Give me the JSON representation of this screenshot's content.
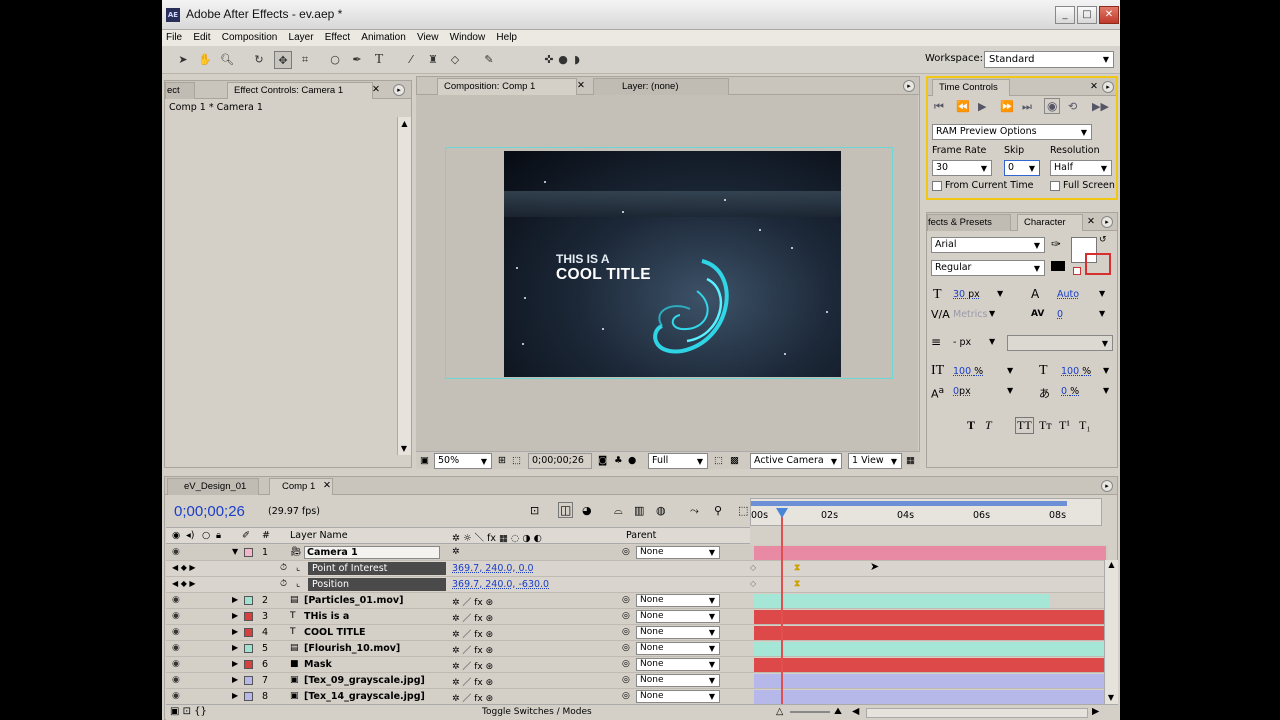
{
  "window": {
    "title": "Adobe After Effects - ev.aep *",
    "logo": "AE"
  },
  "menu": [
    "File",
    "Edit",
    "Composition",
    "Layer",
    "Effect",
    "Animation",
    "View",
    "Window",
    "Help"
  ],
  "workspace": {
    "label": "Workspace:",
    "value": "Standard"
  },
  "effect_controls": {
    "tab_left": "ect",
    "tab": "Effect Controls: Camera 1",
    "subtitle": "Comp 1 * Camera 1"
  },
  "composition": {
    "tab": "Composition: Comp 1",
    "layer_tab": "Layer: (none)",
    "title_line1": "THIS IS A",
    "title_line2": "COOL TITLE",
    "footer": {
      "zoom": "50%",
      "timecode": "0;00;00;26",
      "resolution": "Full",
      "camera": "Active Camera",
      "views": "1 View"
    }
  },
  "time_controls": {
    "tab": "Time Controls",
    "ram_preview": "RAM Preview Options",
    "frame_rate_label": "Frame Rate",
    "frame_rate": "30",
    "skip_label": "Skip",
    "skip": "0",
    "resolution_label": "Resolution",
    "resolution": "Half",
    "from_current": "From Current Time",
    "full_screen": "Full Screen"
  },
  "character": {
    "tab_effects": "fects & Presets",
    "tab": "Character",
    "font": "Arial",
    "style": "Regular",
    "size": "30",
    "size_unit": "px",
    "leading": "Auto",
    "kerning": "Metrics",
    "tracking": "0",
    "stroke_unit": "- px",
    "vscale": "100",
    "hscale": "100",
    "baseline": "0",
    "baseline_unit": "px",
    "tsume": "0",
    "pct": "%"
  },
  "timeline": {
    "tabs": [
      "eV_Design_01",
      "Comp 1"
    ],
    "timecode": "0;00;00;26",
    "fps": "(29.97 fps)",
    "col_layer": "Layer Name",
    "col_parent": "Parent",
    "col_num": "#",
    "ruler": [
      "00s",
      "02s",
      "04s",
      "06s",
      "08s"
    ],
    "footer": "Toggle Switches / Modes",
    "layers": [
      {
        "num": "1",
        "name": "Camera 1",
        "parent": "None",
        "color": "#f2b7c9",
        "bar": "#e88aa3",
        "icon": "camera-icon"
      },
      {
        "num": "2",
        "name": "[Particles_01.mov]",
        "parent": "None",
        "color": "#9fe2d0",
        "bar": "#a5e6d6",
        "icon": "footage-icon"
      },
      {
        "num": "3",
        "name": "THis is a",
        "parent": "None",
        "color": "#d84040",
        "bar": "#dd4848",
        "icon": "text-icon"
      },
      {
        "num": "4",
        "name": "COOL TITLE",
        "parent": "None",
        "color": "#d84040",
        "bar": "#dd4848",
        "icon": "text-icon"
      },
      {
        "num": "5",
        "name": "[Flourish_10.mov]",
        "parent": "None",
        "color": "#9fe2d0",
        "bar": "#a5e6d6",
        "icon": "footage-icon"
      },
      {
        "num": "6",
        "name": "Mask",
        "parent": "None",
        "color": "#d84040",
        "bar": "#dd4848",
        "icon": "solid-icon"
      },
      {
        "num": "7",
        "name": "[Tex_09_grayscale.jpg]",
        "parent": "None",
        "color": "#b7b7e8",
        "bar": "#b5b8e8",
        "icon": "image-icon"
      },
      {
        "num": "8",
        "name": "[Tex_14_grayscale.jpg]",
        "parent": "None",
        "color": "#b7b7e8",
        "bar": "#b5b8e8",
        "icon": "image-icon"
      }
    ],
    "props": [
      {
        "name": "Point of Interest",
        "value": "369.7, 240.0, 0.0"
      },
      {
        "name": "Position",
        "value": "369.7, 240.0, -630.0"
      }
    ]
  }
}
